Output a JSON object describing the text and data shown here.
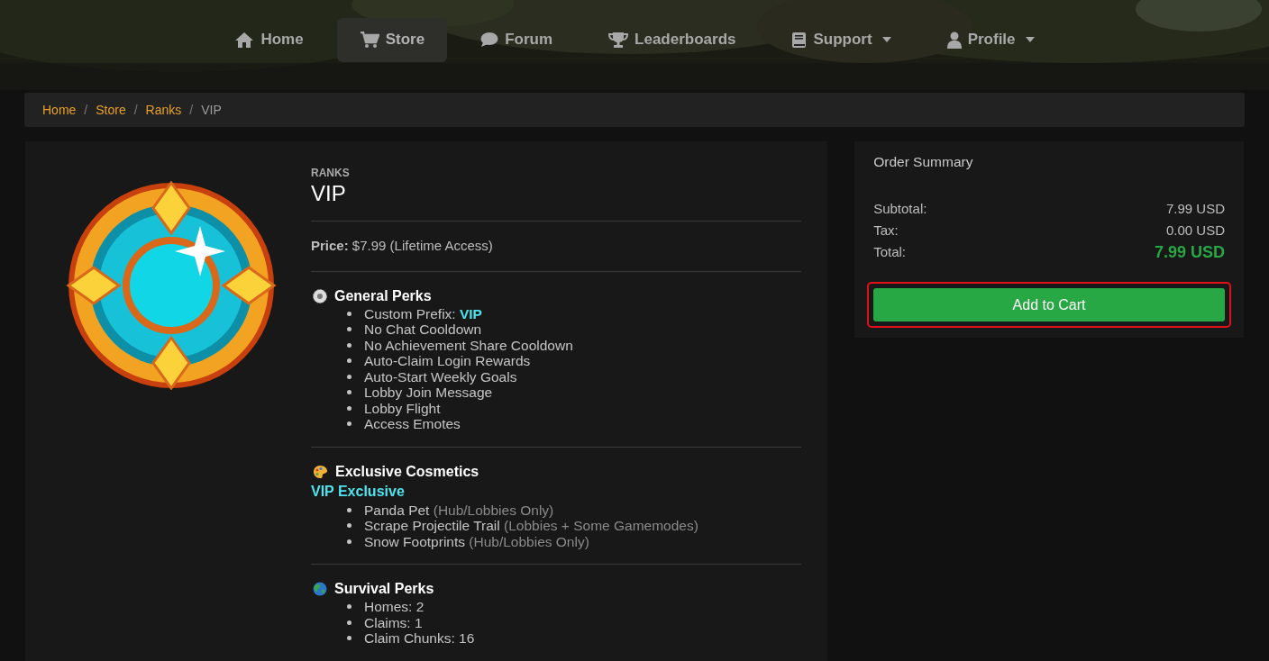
{
  "nav": [
    {
      "label": "Home",
      "kind": "home",
      "selected": false,
      "dropdown": false
    },
    {
      "label": "Store",
      "kind": "cart",
      "selected": true,
      "dropdown": false
    },
    {
      "label": "Forum",
      "kind": "comment",
      "selected": false,
      "dropdown": false
    },
    {
      "label": "Leaderboards",
      "kind": "trophy",
      "selected": false,
      "dropdown": false
    },
    {
      "label": "Support",
      "kind": "book",
      "selected": false,
      "dropdown": true
    },
    {
      "label": "Profile",
      "kind": "user",
      "selected": false,
      "dropdown": true
    }
  ],
  "breadcrumb": [
    {
      "label": "Home",
      "current": false
    },
    {
      "separator": "/",
      "label": "Store",
      "current": false
    },
    {
      "separator": "/",
      "label": "Ranks",
      "current": false
    },
    {
      "separator": "/",
      "label": "VIP",
      "current": true
    }
  ],
  "product": {
    "category": "RANKS",
    "title": "VIP",
    "price": "**Price:** $7.99 (Lifetime Access)",
    "sections": [
      {
        "kind": "general",
        "title": "General Perks",
        "items": [
          {
            "text": "Custom Prefix:",
            "highlight": "VIP"
          },
          {
            "text": "No Chat Cooldown"
          },
          {
            "text": "No Achievement Share Cooldown"
          },
          {
            "text": "Auto-Claim Login Rewards"
          },
          {
            "text": "Auto-Start Weekly Goals"
          },
          {
            "text": "Lobby Join Message"
          },
          {
            "text": "Lobby Flight"
          },
          {
            "text": "Access Emotes"
          }
        ]
      },
      {
        "kind": "cosmetics",
        "title": "Exclusive Cosmetics",
        "subtitle": "VIP Exclusive",
        "items": [
          {
            "text": "Panda Pet",
            "note": "(Hub/Lobbies Only)"
          },
          {
            "text": "Scrape Projectile Trail",
            "note": "(Lobbies + Some Gamemodes)"
          },
          {
            "text": "Snow Footprints",
            "note": "(Hub/Lobbies Only)"
          }
        ]
      },
      {
        "kind": "survival",
        "title": "Survival Perks",
        "items": [
          {
            "text": "Homes: 2"
          },
          {
            "text": "Claims: 1"
          },
          {
            "text": "Claim Chunks: 16"
          }
        ]
      }
    ]
  },
  "summary": {
    "title": "Order Summary",
    "rows": [
      {
        "label": "Subtotal:",
        "value": "7.99 USD",
        "kind": "plain"
      },
      {
        "label": "Tax:",
        "value": "0.00 USD",
        "kind": "plain"
      },
      {
        "label": "Total:",
        "value": "7.99 USD",
        "kind": "total"
      }
    ],
    "button": {
      "label": "Add to Cart",
      "highlighted": true
    }
  }
}
